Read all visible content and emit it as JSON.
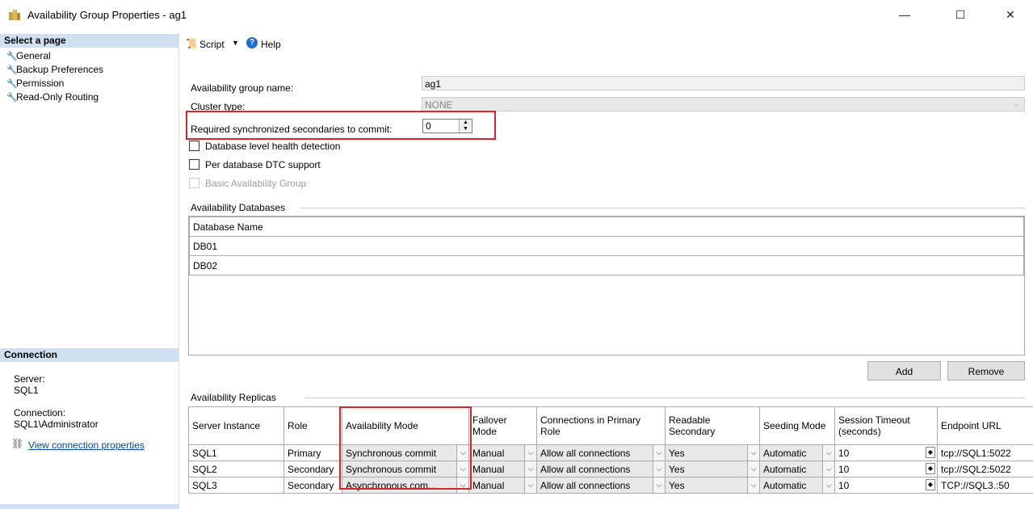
{
  "window": {
    "title": "Availability Group Properties - ag1",
    "minimize": "—",
    "maximize": "☐",
    "close": "✕"
  },
  "left": {
    "select_page_header": "Select a page",
    "pages": [
      "General",
      "Backup Preferences",
      "Permission",
      "Read-Only Routing"
    ],
    "connection_header": "Connection",
    "server_label": "Server:",
    "server_value": "SQL1",
    "connection_label": "Connection:",
    "connection_value": "SQL1\\Administrator",
    "view_connection_link": "View connection properties"
  },
  "toolbar": {
    "script_label": "Script",
    "help_label": "Help"
  },
  "form": {
    "ag_name_label": "Availability group name:",
    "ag_name_value": "ag1",
    "cluster_type_label": "Cluster type:",
    "cluster_type_value": "NONE",
    "req_sync_label": "Required synchronized secondaries to commit:",
    "req_sync_value": "0",
    "db_health_label": "Database level health detection",
    "dtc_label": "Per database DTC support",
    "basic_ag_label": "Basic Availability Group"
  },
  "databases": {
    "group_label": "Availability Databases",
    "column_header": "Database Name",
    "rows": [
      "DB01",
      "DB02"
    ],
    "add_button": "Add",
    "remove_button": "Remove"
  },
  "replicas": {
    "group_label": "Availability Replicas",
    "headers": {
      "server_instance": "Server Instance",
      "role": "Role",
      "availability_mode": "Availability Mode",
      "failover_mode": "Failover Mode",
      "connections_primary": "Connections in Primary Role",
      "readable_secondary": "Readable Secondary",
      "seeding_mode": "Seeding Mode",
      "session_timeout": "Session Timeout (seconds)",
      "endpoint_url": "Endpoint URL"
    },
    "rows": [
      {
        "server": "SQL1",
        "role": "Primary",
        "mode": "Synchronous commit",
        "failover": "Manual",
        "connections": "Allow all connections",
        "readable": "Yes",
        "seeding": "Automatic",
        "timeout": "10",
        "endpoint": "tcp://SQL1:5022"
      },
      {
        "server": "SQL2",
        "role": "Secondary",
        "mode": "Synchronous commit",
        "failover": "Manual",
        "connections": "Allow all connections",
        "readable": "Yes",
        "seeding": "Automatic",
        "timeout": "10",
        "endpoint": "tcp://SQL2:5022"
      },
      {
        "server": "SQL3",
        "role": "Secondary",
        "mode": "Asynchronous com...",
        "failover": "Manual",
        "connections": "Allow all connections",
        "readable": "Yes",
        "seeding": "Automatic",
        "timeout": "10",
        "endpoint": "TCP://SQL3.:50"
      }
    ]
  },
  "colors": {
    "highlight_box": "#d9242a",
    "section_header": "#cfe0f1",
    "link": "#0645ad"
  }
}
